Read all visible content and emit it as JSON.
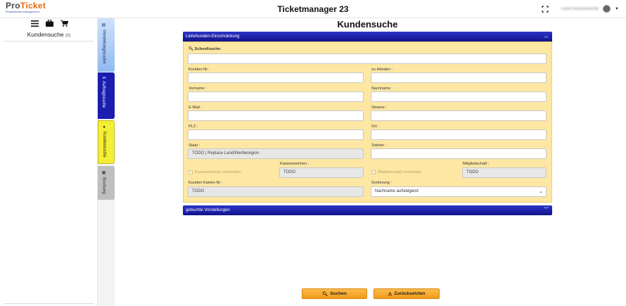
{
  "app": {
    "title": "Ticketmanager 23",
    "logo_text_a": "Pro",
    "logo_text_b": "Ticket",
    "logo_tagline": "Eintrittskartenmanagement",
    "user_name": "David Muskantschik"
  },
  "left_panel": {
    "title": "Kundensuche",
    "count": "(0)"
  },
  "vertical_tabs": [
    {
      "label": "Vorstellungssuche",
      "icon": "calendar-icon"
    },
    {
      "label": "Auftragssuche",
      "icon": "euro-icon"
    },
    {
      "label": "Kundensuche",
      "icon": "person-icon"
    },
    {
      "label": "Buchung",
      "icon": "grid-icon"
    }
  ],
  "main": {
    "title": "Kundensuche",
    "section1_title": "Lieferkunden-Einschränkung",
    "section2_title": "gebuchte Vorstellungen",
    "quicksearch_label": "Schnellsuche:",
    "quicksearch_value": "",
    "fields": {
      "kundennr_label": "Kunden-Nr :",
      "zuhaenden_label": "zu Händen :",
      "vorname_label": "Vorname :",
      "nachname_label": "Nachname :",
      "email_label": "E-Mail :",
      "strasse_label": "Strasse :",
      "plz_label": "PLZ :",
      "ort_label": "Ort :",
      "staat_label": "Staat :",
      "staat_value": "TODO | Replace Land/Werberegion",
      "telefon_label": "Telefon :",
      "kassenzeichen_cb_label": "Kassenzeichen vorhanden",
      "kassenzeichen_label": "Kassenzeichen :",
      "kassenzeichen_value": "TODO",
      "mitglied_cb_label": "Mitgliedschaft vorhanden",
      "mitglied_label": "Mitgliedschaft :",
      "mitglied_value": "TODO",
      "kartennr_label": "Kunden-Karten-Nr :",
      "kartennr_value": "TODO",
      "sortierung_label": "Sortierung :",
      "sortierung_value": "Nachname aufsteigend"
    }
  },
  "buttons": {
    "search": "Suchen",
    "reset": "Zurücksetzten"
  },
  "colors": {
    "panel_header": "#1a1dae",
    "panel_body": "#fde7a2",
    "button": "#f7a92e",
    "active_tab": "#f4ee34"
  }
}
